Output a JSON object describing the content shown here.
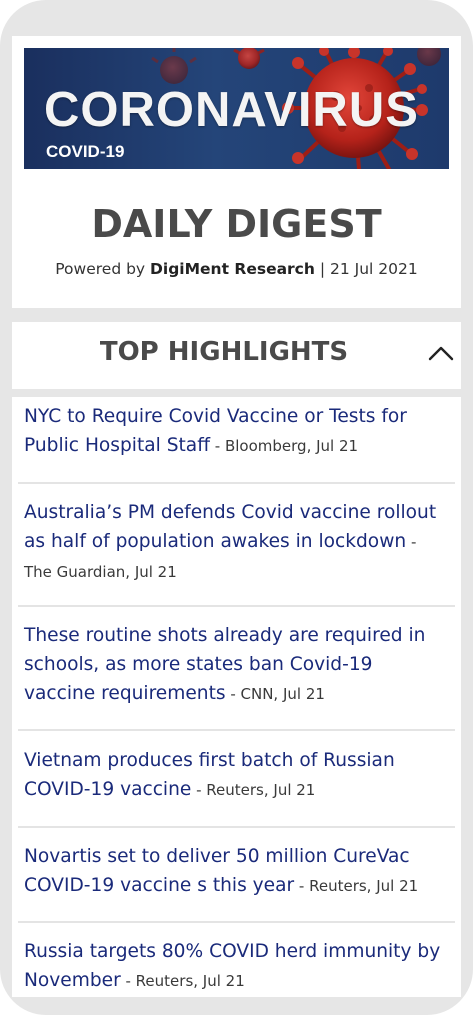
{
  "banner": {
    "title": "CORONAVIRUS",
    "subtitle": "COVID-19"
  },
  "digest": {
    "title": "DAILY DIGEST",
    "powered_prefix": "Powered by ",
    "company": "DigiMent Research",
    "date_suffix": " | 21 Jul 2021"
  },
  "highlights": {
    "title": "TOP HIGHLIGHTS",
    "items": [
      {
        "headline": "NYC to Require Covid Vaccine or Tests for Public Hospital Staff",
        "source": " - Bloomberg, Jul 21"
      },
      {
        "headline": "Australia’s PM defends Covid vaccine rollout as half of population awakes in lockdown",
        "source": " - The Guardian, Jul 21"
      },
      {
        "headline": "These routine shots already are required in schools, as more states ban Covid-19 vaccine requirements",
        "source": " - CNN, Jul 21"
      },
      {
        "headline": "Vietnam produces first batch of Russian COVID-19 vaccine",
        "source": " - Reuters, Jul 21"
      },
      {
        "headline": "Novartis set to deliver 50 million CureVac COVID-19 vaccine s this year",
        "source": " - Reuters, Jul 21"
      },
      {
        "headline": "Russia targets 80% COVID herd immunity by November",
        "source": " - Reuters, Jul 21"
      }
    ]
  },
  "colors": {
    "headline": "#1a2a7a",
    "banner_bg": "#1e3a6c",
    "virus": "#c0281e"
  },
  "icons": {
    "collapse": "chevron-up-icon",
    "banner_art": "virus-icon"
  }
}
